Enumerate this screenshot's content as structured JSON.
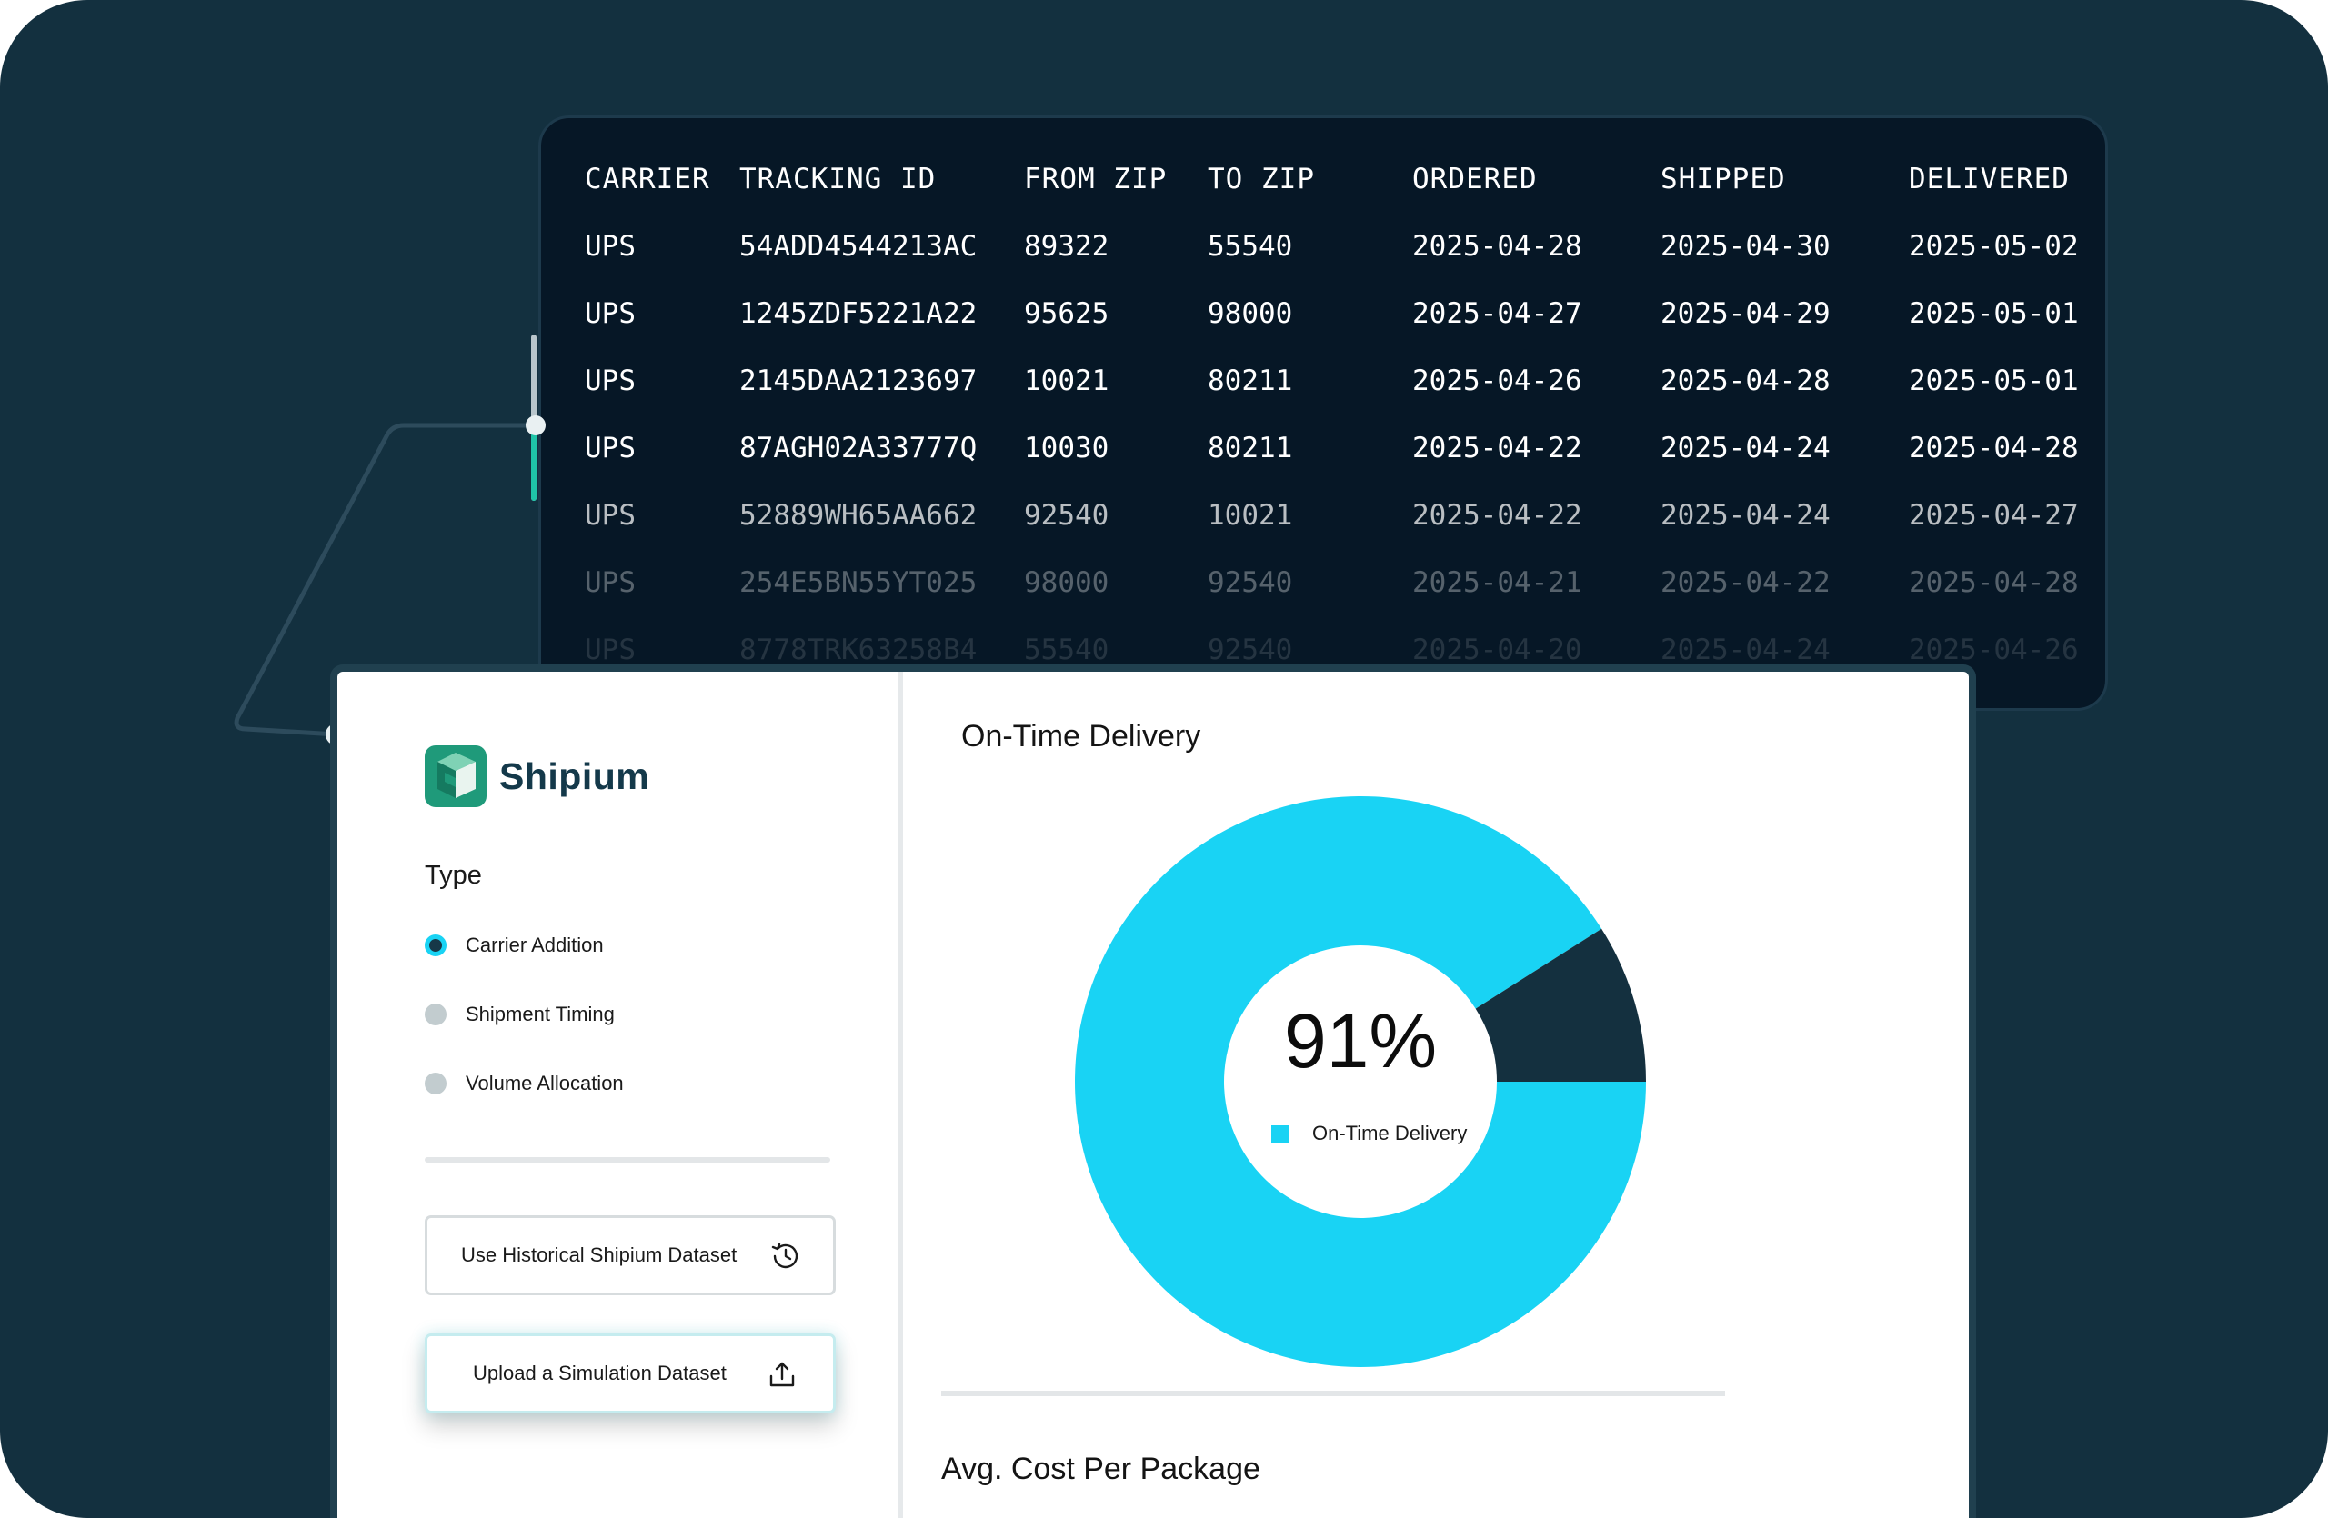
{
  "table": {
    "headers": [
      "CARRIER",
      "TRACKING ID",
      "FROM ZIP",
      "TO ZIP",
      "ORDERED",
      "SHIPPED",
      "DELIVERED"
    ],
    "rows": [
      [
        "UPS",
        "54ADD4544213AC",
        "89322",
        "55540",
        "2025-04-28",
        "2025-04-30",
        "2025-05-02"
      ],
      [
        "UPS",
        "1245ZDF5221A22",
        "95625",
        "98000",
        "2025-04-27",
        "2025-04-29",
        "2025-05-01"
      ],
      [
        "UPS",
        "2145DAA2123697",
        "10021",
        "80211",
        "2025-04-26",
        "2025-04-28",
        "2025-05-01"
      ],
      [
        "UPS",
        "87AGH02A33777Q",
        "10030",
        "80211",
        "2025-04-22",
        "2025-04-24",
        "2025-04-28"
      ],
      [
        "UPS",
        "52889WH65AA662",
        "92540",
        "10021",
        "2025-04-22",
        "2025-04-24",
        "2025-04-27"
      ],
      [
        "UPS",
        "254E5BN55YT025",
        "98000",
        "92540",
        "2025-04-21",
        "2025-04-22",
        "2025-04-28"
      ],
      [
        "UPS",
        "8778TRK63258B4",
        "55540",
        "92540",
        "2025-04-20",
        "2025-04-24",
        "2025-04-26"
      ]
    ]
  },
  "brand": {
    "name": "Shipium"
  },
  "sidebar": {
    "type_heading": "Type",
    "options": [
      {
        "label": "Carrier Addition",
        "selected": true
      },
      {
        "label": "Shipment Timing",
        "selected": false
      },
      {
        "label": "Volume Allocation",
        "selected": false
      }
    ],
    "historical_button": {
      "label": "Use Historical Shipium Dataset",
      "icon": "history-icon"
    },
    "upload_button": {
      "label": "Upload a Simulation Dataset",
      "icon": "upload-icon"
    }
  },
  "main": {
    "chart_title": "On-Time Delivery",
    "section_title": "Avg. Cost Per Package"
  },
  "chart_data": {
    "type": "pie",
    "categories": [
      "On-Time Delivery",
      ""
    ],
    "values": [
      91,
      9
    ],
    "center_value": "91%",
    "legend": [
      "On-Time Delivery"
    ],
    "colors": [
      "#19d3f4",
      "#14303f"
    ]
  },
  "colors": {
    "background": "#13303f",
    "accent": "#19d3f4",
    "brand_dark": "#14394a",
    "brand_green": "#1f9a7a"
  }
}
